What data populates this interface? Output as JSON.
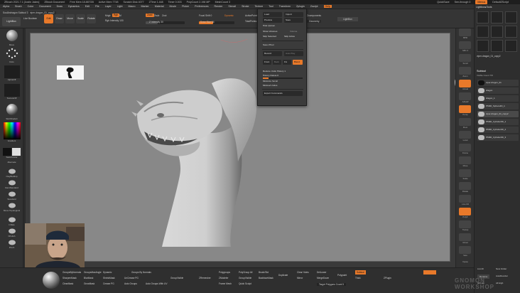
{
  "titlebar": {
    "items": [
      "ZBrush 2021.7.1 [Justin Jakes]",
      "ZBrush Document",
      "Free Mem 18.887GB",
      "Active Mem 7748",
      "Scratch Disk 4077",
      "ZTime 1.448",
      "Timer 0.003",
      "PolyCount 2.198 MP",
      "MeshCount 3"
    ],
    "quicksave": "QuickSave",
    "seethrough": "See-through 0",
    "menus": "Menus",
    "default_script": "DefaultZScript"
  },
  "menubar": {
    "items": [
      "Alpha",
      "Brush",
      "Color",
      "Document",
      "Draw",
      "Dynamics",
      "Edit",
      "File",
      "Layer",
      "Light",
      "Macro",
      "Marker",
      "Material",
      "Movie",
      "Picker",
      "Preferences",
      "Render",
      "Stencil",
      "Stroke",
      "Texture",
      "Tool",
      "Transform",
      "Zplugin",
      "Zscript",
      "Help"
    ],
    "active_index": 24
  },
  "toolbar": {
    "mrgb": "Mrgb",
    "rgb": "Rgb",
    "m": "M",
    "zadd": "Zadd",
    "zsub": "Zsub",
    "zcut": "Zcut",
    "rgb_intensity": "Rgb Intensity 100",
    "z_intensity": "Z Intensity 30",
    "focal_shift": "Focal Shift 0",
    "draw_size": "Draw Size 64",
    "dynamic": "Dynamic",
    "active_points": "ActivePoints: 2.198 Mil",
    "total_points": "TotalPoints: 2.198 Mil",
    "lightbox": "LightBox",
    "live_boolean": "Live Boolean",
    "edit": "Edit",
    "draw": "Draw",
    "move": "Move",
    "scale": "Scale",
    "rotate": "Rotate",
    "tool_label": "SoulArchagon Subtool 3",
    "tool_field": "viper-dragon_01_copy2",
    "texture_label": "Texture Off",
    "zcomponents": "Zcomponents",
    "geometry": "Geometry",
    "channel": "Ch"
  },
  "left_shelf": {
    "items": [
      "Move",
      "Dots",
      "AlphaOff",
      "TextureOff",
      "SkinShade4",
      "Gradient",
      "SwitchColor",
      "Alternate",
      "ClayBuildup",
      "DamStandard",
      "Standard",
      "Move Topological",
      "Inflate",
      "hPolish",
      "Pinch"
    ]
  },
  "right_shelf": {
    "items": [
      "BPR",
      "SPix 3",
      "Scroll",
      "Zoom",
      "Actual",
      "AAHalf",
      "Persp",
      "Floor",
      "Local",
      "Frame",
      "Move",
      "Scale",
      "Rotate",
      "Line Fill",
      "PolyF",
      "Transp",
      "Ghost",
      "Solo",
      "Xpose"
    ]
  },
  "right_panel": {
    "lightbox_tools": "Lightbox▸Tools",
    "tool_name": "viper-dragon_01_copy2",
    "subtool_title": "Subtool",
    "visible_count": "Visible Count 7/8",
    "subtools": [
      "viper-dragon_01",
      "dragon",
      "dragon_1",
      "PM3D_Sphere3D_1",
      "viper-dragon_01_copy2",
      "PM3D_Cylinder3D_1",
      "PM3D_Cylinder3D_2",
      "PM3D_Cylinder3D_3"
    ],
    "selected_index": 4,
    "list_all": "List All",
    "new_folder": "New Folder",
    "rename": "Rename",
    "autoreorder": "AutoReorder",
    "all_low": "All Low",
    "all_high": "All High"
  },
  "dropdown": {
    "title": "Subtool",
    "rows": [
      [
        "Load",
        "Import"
      ],
      [
        "Preview",
        "Save"
      ],
      [
        "Hide Quinen"
      ],
      [
        "Show Volumes",
        "Volume"
      ],
      [
        "Skip Selected",
        "Skip Active"
      ],
      [
        "Save ZTool"
      ],
      [
        "Record",
        "Auto Play"
      ],
      [
        "Front",
        "Back",
        "Fix",
        "Blend"
      ],
      [
        "Restore Undo History 1"
      ],
      [
        "History Delete 0"
      ],
      [
        "Minimize Scroll"
      ],
      [
        "Minimal Undos"
      ],
      [
        "Export Commands"
      ]
    ]
  },
  "bottombar": {
    "labels": [
      "GroupsByNormals",
      "GroupsMaxAngle",
      "Dynamic",
      "Groups By Normals",
      "SharpenMask",
      "BlurMask",
      "ClearMask",
      "GrowMask",
      "ShrinkMask",
      "Crease PG",
      "UnCrease PG",
      "Auto Groups",
      "Auto Groups With UV",
      "GroupVisible",
      "ZRemesher",
      "Polygroups",
      "ZModeler",
      "Frame Mesh",
      "PolyGroup All",
      "GroupVisible",
      "Brush/Std",
      "BackfaceMask",
      "Quick Sculpt",
      "Duplicate",
      "Clear Holes",
      "Mirror",
      "MergeDown",
      "DelLower",
      "Target Polygons Count 5",
      "Polypaint",
      "Thick",
      "ZPlugin"
    ],
    "active": "Subtool"
  },
  "watermark": "GNOMON WORKSHOP",
  "colors": {
    "accent": "#e8792a",
    "canvas": "#888888",
    "panel": "#2e2e2e",
    "model": "#cfcfcf"
  }
}
